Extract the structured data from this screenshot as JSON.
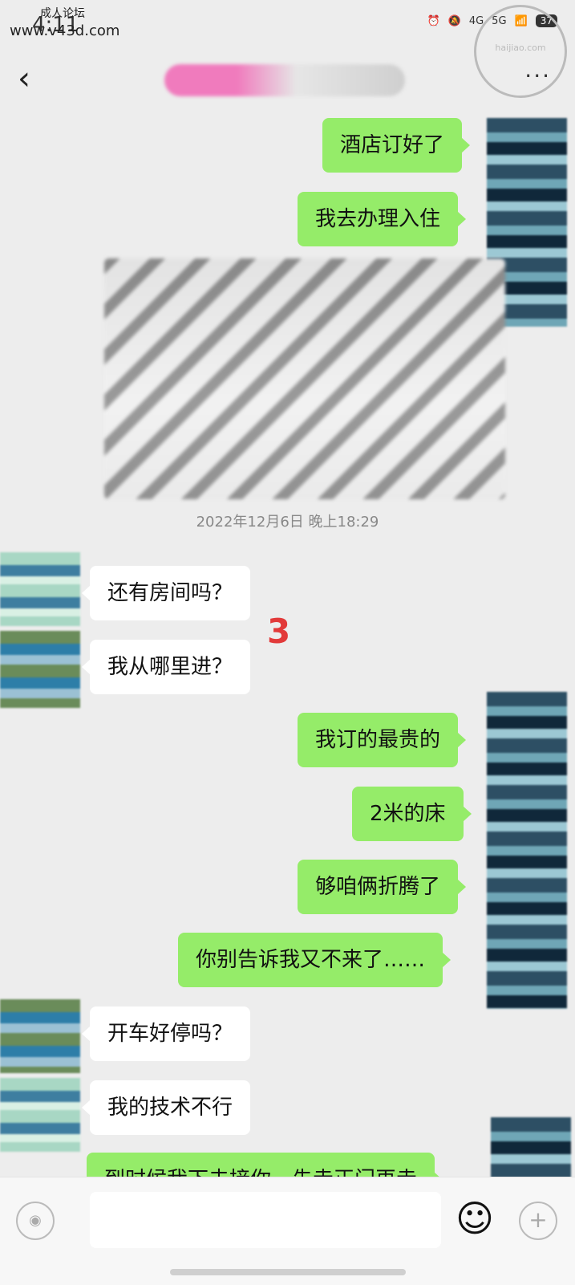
{
  "status": {
    "time": "4:11",
    "watermark_top": "成人论坛",
    "watermark_url": "www.v43d.com",
    "network_1": "4G",
    "network_2": "5G",
    "battery": "37"
  },
  "header": {
    "back": "‹",
    "more": "···"
  },
  "stamp": {
    "text": "haijiao.com"
  },
  "messages_top": [
    {
      "text": "酒店订好了"
    },
    {
      "text": "我去办理入住"
    }
  ],
  "time_separator": "2022年12月6日 晚上18:29",
  "badge": "3",
  "messages_middle": [
    {
      "text": "还有房间吗？"
    },
    {
      "text": "我从哪里进？"
    },
    {
      "text": "我订的最贵的"
    },
    {
      "text": "2米的床"
    },
    {
      "text": "够咱俩折腾了"
    },
    {
      "text": "你别告诉我又不来了……"
    },
    {
      "text": "开车好停吗？"
    },
    {
      "text": "我的技术不行"
    },
    {
      "text": "到时候我下去接你，先走正门再走"
    }
  ],
  "input": {
    "placeholder": "",
    "value": ""
  },
  "icons": {
    "voice": "voice-icon",
    "emoji": "emoji-icon",
    "plus": "plus-icon"
  }
}
